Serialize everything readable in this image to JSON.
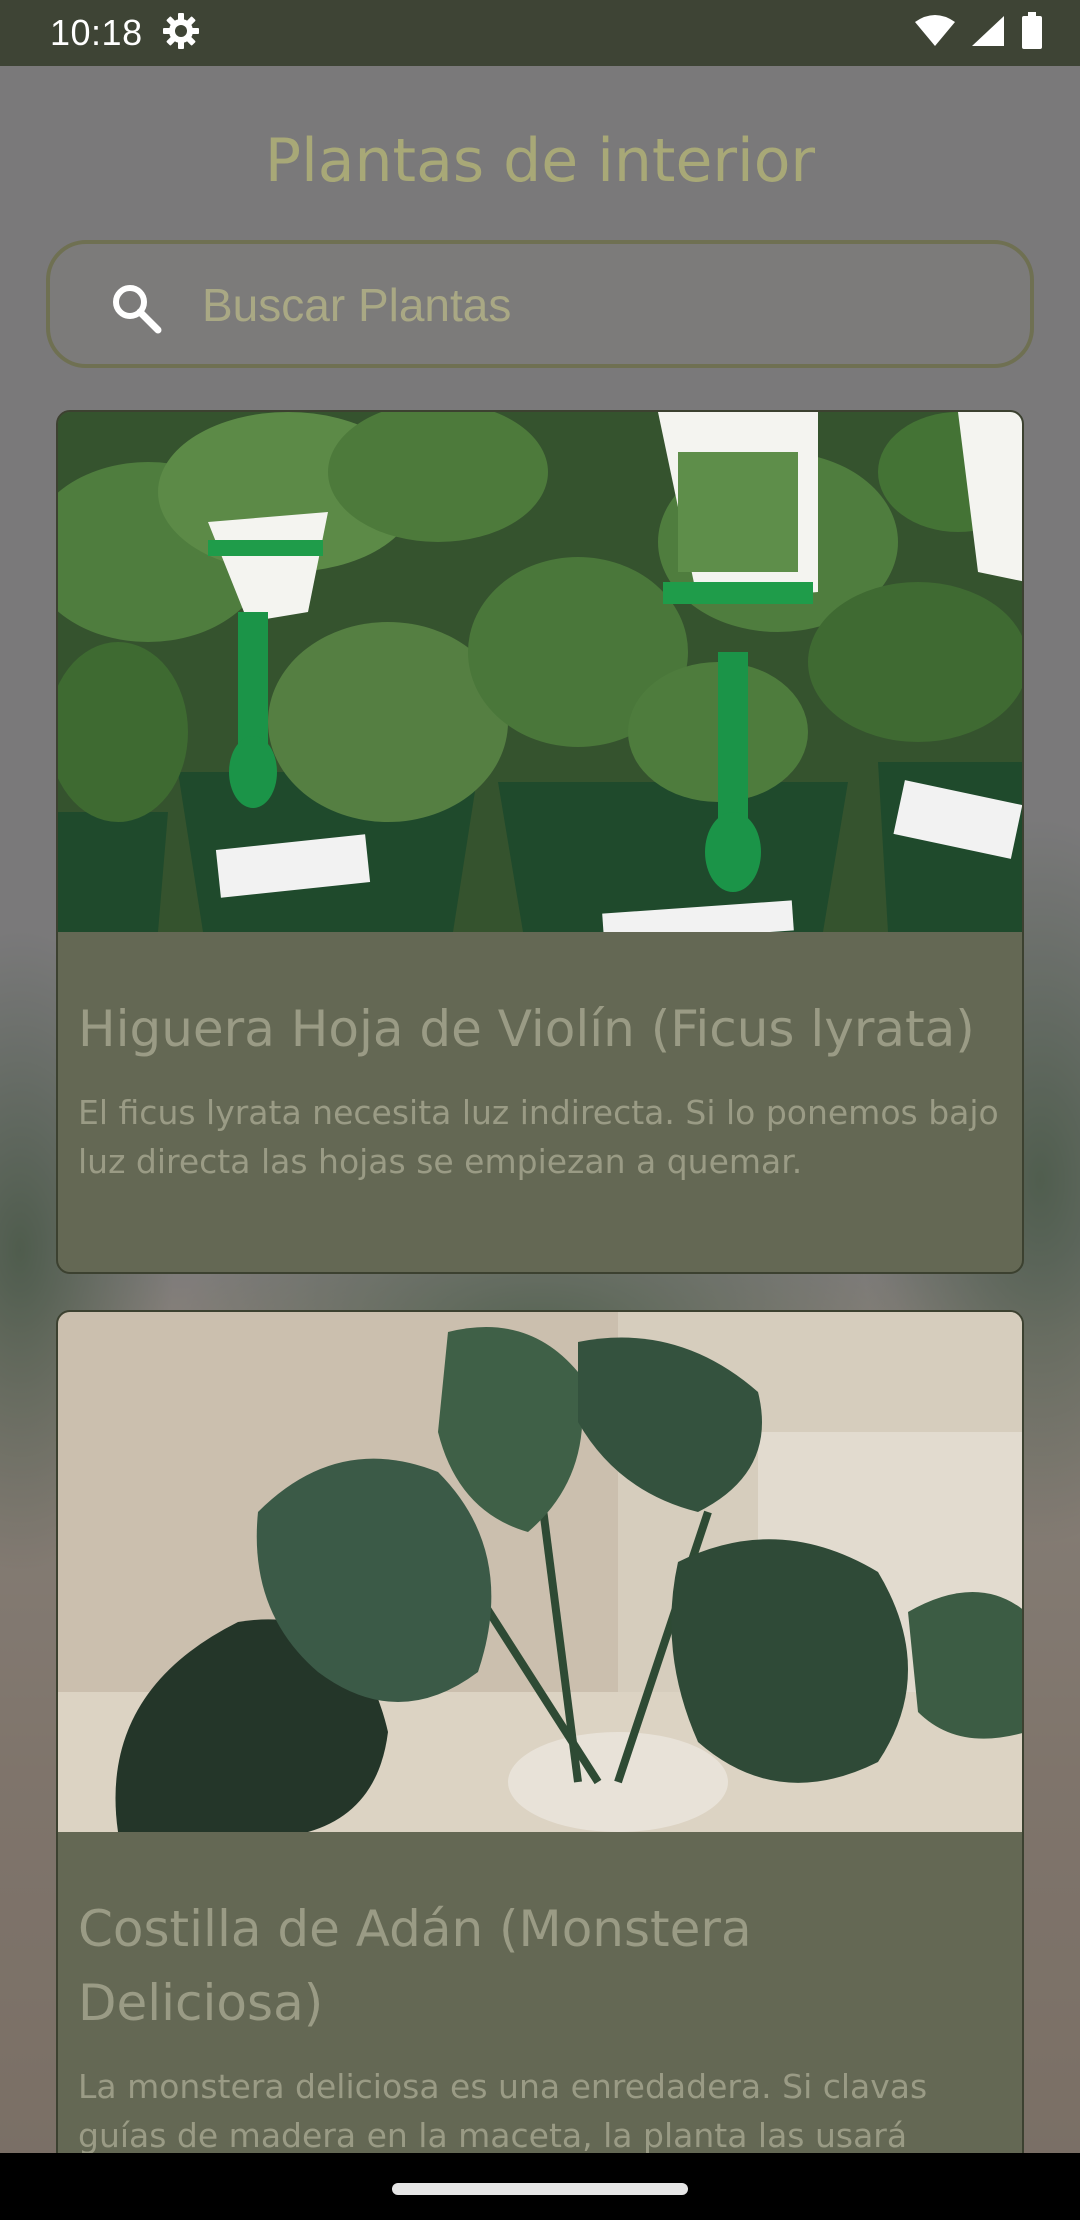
{
  "status_bar": {
    "time": "10:18",
    "icons": [
      "settings-gear-icon",
      "wifi-icon",
      "cellular-signal-icon",
      "battery-icon"
    ]
  },
  "page": {
    "title": "Plantas de interior"
  },
  "search": {
    "placeholder": "Buscar Plantas",
    "icon": "search-icon"
  },
  "plants": [
    {
      "title": "Higuera Hoja de Violín (Ficus lyrata)",
      "description": "El ficus lyrata necesita luz indirecta. Si lo ponemos bajo luz directa las hojas se empiezan a quemar.",
      "image_desc_icon": "ficus-plant-image"
    },
    {
      "title": "Costilla de Adán (Monstera Deliciosa)",
      "description": "La monstera deliciosa es una enredadera. Si clavas guías de madera en la maceta, la planta las usará",
      "image_desc_icon": "monstera-plant-image"
    }
  ],
  "colors": {
    "status_bar": "#3e4435",
    "card_bg": "#646854",
    "title_text": "#a8a877",
    "card_text": "#9a9b85"
  }
}
